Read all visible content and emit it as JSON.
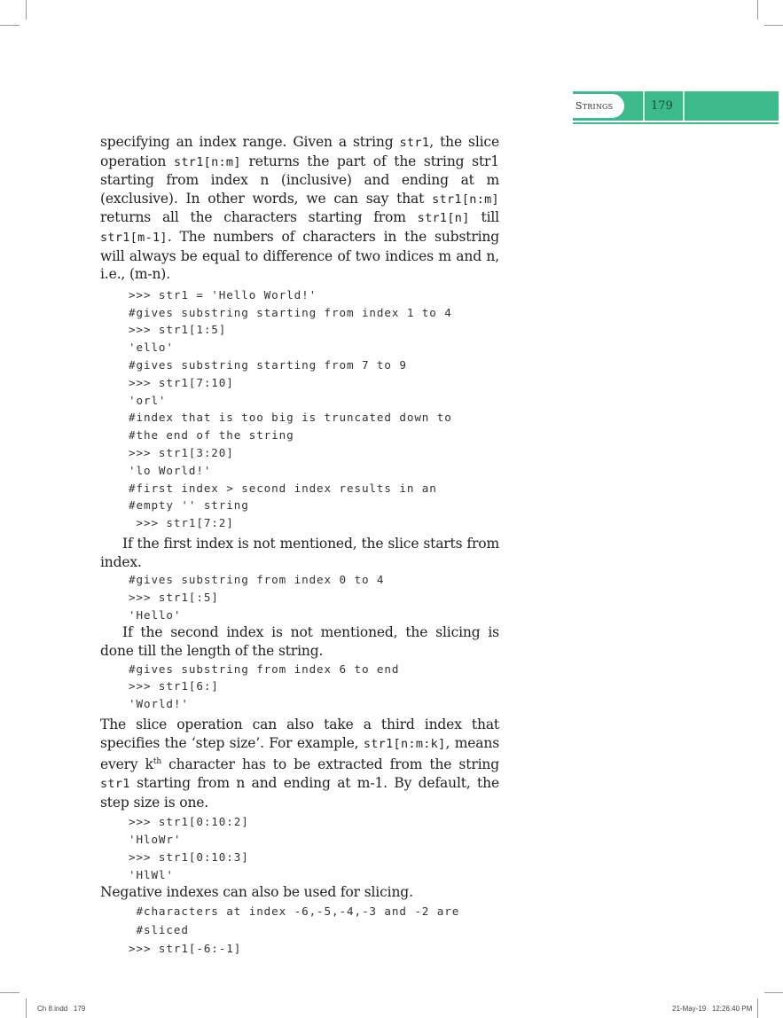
{
  "header": {
    "section_title": "Strings",
    "page_number": "179",
    "accent_color": "#3dba8c"
  },
  "body": {
    "p1": [
      {
        "t": "specifying an index range. Given a string "
      },
      {
        "c": "str1"
      },
      {
        "t": ", the slice operation "
      },
      {
        "c": "str1[n:m]"
      },
      {
        "t": " returns the part of the string str1 starting from index n (inclusive) and ending at m (exclusive). In other words, we can say that "
      },
      {
        "c": "str1[n:m]"
      },
      {
        "t": " returns all the characters starting from "
      },
      {
        "c": "str1[n]"
      },
      {
        "t": " till "
      },
      {
        "c": "str1[m-1]"
      },
      {
        "t": ". The numbers of characters in the substring will always be equal to difference of two indices m and n, i.e., (m-n)."
      }
    ],
    "code1": [
      ">>> str1 = 'Hello World!'",
      "#gives substring starting from index 1 to 4",
      ">>> str1[1:5]",
      "'ello'",
      "#gives substring starting from 7 to 9",
      ">>> str1[7:10]",
      "'orl'",
      "#index that is too big is truncated down to",
      "#the end of the string",
      ">>> str1[3:20]",
      "'lo World!'",
      "#first index > second index results in an",
      "#empty '' string",
      " >>> str1[7:2]"
    ],
    "p2": "If the first index is not mentioned, the slice starts from index.",
    "code2": [
      "#gives substring from index 0 to 4",
      ">>> str1[:5]",
      "'Hello'"
    ],
    "p3": "If the second index is not mentioned, the slicing is done till the length of the string.",
    "code3": [
      "#gives substring from index 6 to end",
      ">>> str1[6:]",
      "'World!'"
    ],
    "p4": [
      {
        "t": "The slice operation can also take a third index that specifies the ‘step size’. For example, "
      },
      {
        "c": "str1[n:m:k]"
      },
      {
        "t": ", means every k"
      },
      {
        "sup": "th"
      },
      {
        "t": " character has to be extracted from the string "
      },
      {
        "c": "str1"
      },
      {
        "t": " starting from n and ending at m-1. By default, the step size is one."
      }
    ],
    "code4": [
      ">>> str1[0:10:2]",
      "'HloWr'",
      ">>> str1[0:10:3]",
      "'HlWl'"
    ],
    "p5": "Negative indexes can also be used for slicing.",
    "code5": [
      " #characters at index -6,-5,-4,-3 and -2 are",
      " #sliced",
      ">>> str1[-6:-1]"
    ]
  },
  "footer": {
    "file_info": "Ch 8.indd   179",
    "timestamp": "21-May-19   12:26:40 PM"
  }
}
